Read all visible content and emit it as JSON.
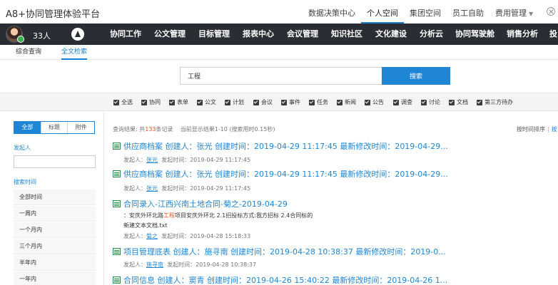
{
  "app": {
    "title": "A8+协同管理体验平台"
  },
  "top_nav": [
    {
      "label": "数据决策中心",
      "active": false,
      "caret": false
    },
    {
      "label": "个人空间",
      "active": true,
      "caret": false
    },
    {
      "label": "集团空间",
      "active": false,
      "caret": false
    },
    {
      "label": "员工自助",
      "active": false,
      "caret": false
    },
    {
      "label": "费用管理",
      "active": false,
      "caret": true
    }
  ],
  "user": {
    "count": "33人"
  },
  "main_nav": [
    "协同工作",
    "公文管理",
    "目标管理",
    "报表中心",
    "会议管理",
    "知识社区",
    "文化建设",
    "分析云",
    "协同驾驶舱",
    "销售分析",
    "投"
  ],
  "sub_tabs": [
    {
      "label": "综合查询",
      "active": false
    },
    {
      "label": "全文检索",
      "active": true
    }
  ],
  "search": {
    "value": "工程",
    "button_label": "搜索"
  },
  "filters": [
    "全选",
    "协同",
    "表单",
    "公文",
    "计划",
    "会议",
    "事件",
    "任务",
    "新闻",
    "公告",
    "调查",
    "讨论",
    "文档",
    "第三方待办"
  ],
  "left_panel": {
    "segments": [
      {
        "label": "全部",
        "active": true
      },
      {
        "label": "标题",
        "active": false
      },
      {
        "label": "附件",
        "active": false
      }
    ],
    "initiator_label": "发起人",
    "search_time_label": "搜索时间",
    "time_options": [
      "全部时间",
      "一周内",
      "一个月内",
      "三个月内",
      "半年内",
      "一年内"
    ]
  },
  "results_summary": {
    "prefix": "查询结果: 共",
    "count": "133",
    "suffix": "条记录",
    "page_info": "当前显示结果1-10 (搜索用时0.15秒)",
    "sort_time": "按时间排序",
    "sort_sep": "|",
    "sort_other": "按"
  },
  "results": [
    {
      "title": "供应商档案 创建人：张光 创建时间：2019-04-29 11:17:45 最新修改时间：2019-04-29...",
      "meta_label": "发起人：",
      "meta_user": "张光",
      "meta_time": "发起时间：2019-04-29 11:17:45",
      "snippet": []
    },
    {
      "title": "供应商档案 创建人：张光 创建时间：2019-04-29 11:17:45 最新修改时间：2019-04-29...",
      "meta_label": "发起人：",
      "meta_user": "张光",
      "meta_time": "发起时间：2019-04-29 11:17:45",
      "snippet": []
    },
    {
      "title": "合同录入-江西兴南土地合同-菊之-2019-04-29",
      "meta_label": "发起人：",
      "meta_user": "菊之",
      "meta_time": "发起时间：2019-04-28 15:18:33",
      "snippet": [
        {
          "before": "：安庆外环北路",
          "highlight": "工程",
          "after": "项目安庆外环北 2.1招投标方式:我方招标 2.4合同标的"
        },
        {
          "before": "新建文本文档.txt",
          "highlight": "",
          "after": ""
        }
      ]
    },
    {
      "title": "项目管理底表 创建人：施寻南 创建时间：2019-04-28 10:38:37 最新修改时间：2019-0...",
      "meta_label": "发起人：",
      "meta_user": "施寻南",
      "meta_time": "发起时间：2019-04-28 10:38:37",
      "snippet": []
    },
    {
      "title": "合同信息 创建人：窦青 创建时间：2019-04-26 15:40:22 最新修改时间：2019-04-26 1...",
      "meta_label": "",
      "meta_user": "",
      "meta_time": "",
      "snippet": []
    }
  ]
}
